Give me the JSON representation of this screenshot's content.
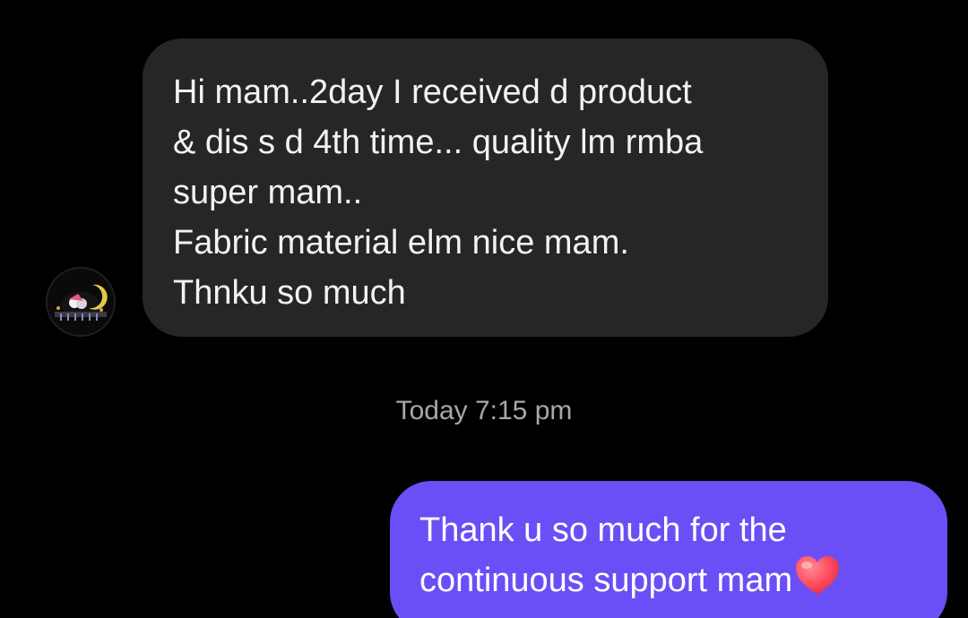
{
  "conversation": {
    "incoming_message": {
      "lines": [
        "Hi mam..2day I received d product",
        "& dis s d 4th time... quality lm rmba",
        "super mam..",
        "Fabric material elm nice mam.",
        "Thnku so much"
      ],
      "avatar_icon": "profile-photo-icon"
    },
    "timestamp": "Today 7:15 pm",
    "outgoing_message": {
      "lines": [
        "Thank u so much for the",
        "continuous support mam"
      ],
      "emoji": "heart-icon"
    }
  },
  "colors": {
    "background": "#000000",
    "incoming_bubble": "#262626",
    "outgoing_bubble": "#6a4ff6",
    "timestamp_text": "#a8a8a8",
    "heart": "#ff4a5e"
  }
}
